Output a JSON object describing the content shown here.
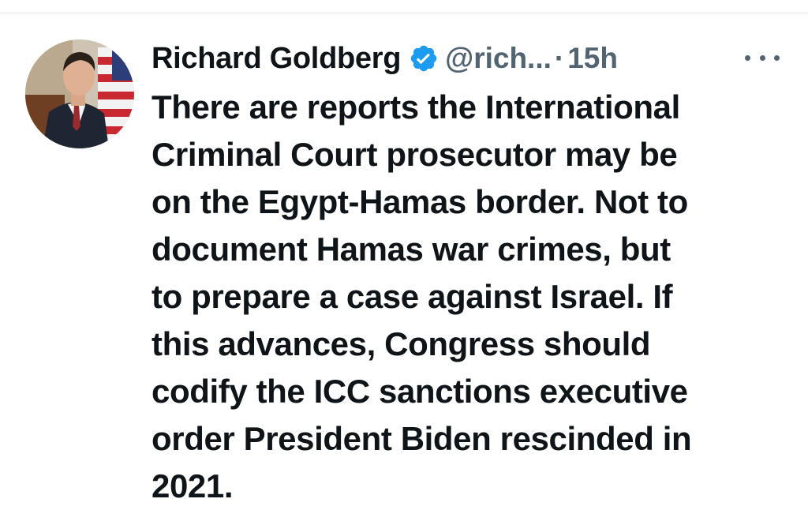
{
  "tweet": {
    "author_name": "Richard Goldberg",
    "handle": "@rich...",
    "separator": "·",
    "timestamp": "15h",
    "verified_color": "#1d9bf0",
    "text_lines": [
      "There are reports the International",
      "Criminal Court prosecutor may be",
      "on the Egypt-Hamas border. Not to",
      "document Hamas war crimes, but",
      "to prepare a case against Israel. If",
      "this advances, Congress should",
      "codify the ICC sanctions executive",
      "order President Biden rescinded in",
      "2021."
    ]
  },
  "icons": {
    "verified": "verified-badge-icon",
    "more": "more-options-icon"
  }
}
